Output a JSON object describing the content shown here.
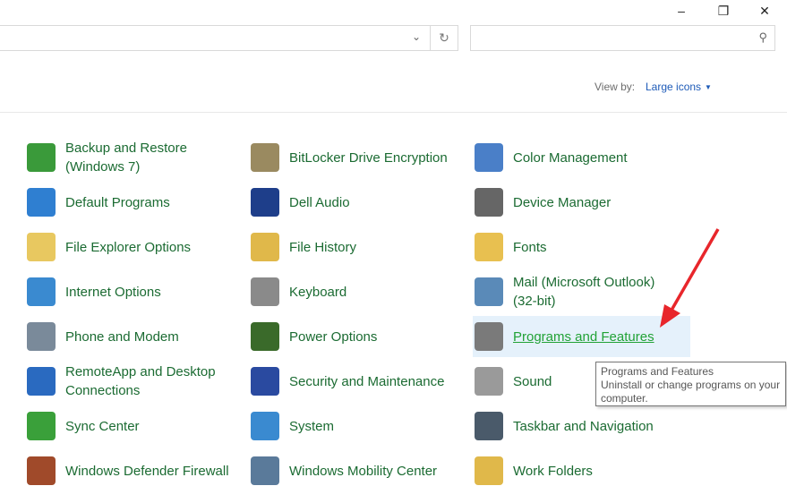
{
  "window": {
    "minimize": "–",
    "restore": "❐",
    "close": "✕"
  },
  "address": {
    "value": "",
    "chevron": "⌄",
    "refresh": "↻"
  },
  "search": {
    "placeholder": "",
    "icon": "⚲"
  },
  "view_by": {
    "label": "View by:",
    "value": "Large icons"
  },
  "items": [
    {
      "label": "Backup and Restore (Windows 7)",
      "icon": "backup-icon",
      "color": "#3a9a3a"
    },
    {
      "label": "BitLocker Drive Encryption",
      "icon": "bitlocker-icon",
      "color": "#9a8a60"
    },
    {
      "label": "Color Management",
      "icon": "color-management-icon",
      "color": "#4a7fc8"
    },
    {
      "label": "Default Programs",
      "icon": "default-programs-icon",
      "color": "#2f7fd1"
    },
    {
      "label": "Dell Audio",
      "icon": "dell-audio-icon",
      "color": "#1e3e8a"
    },
    {
      "label": "Device Manager",
      "icon": "device-manager-icon",
      "color": "#666666"
    },
    {
      "label": "File Explorer Options",
      "icon": "folder-options-icon",
      "color": "#e8c860"
    },
    {
      "label": "File History",
      "icon": "file-history-icon",
      "color": "#e0b84a"
    },
    {
      "label": "Fonts",
      "icon": "fonts-icon",
      "color": "#e8c050"
    },
    {
      "label": "Internet Options",
      "icon": "globe-icon",
      "color": "#3a8ad0"
    },
    {
      "label": "Keyboard",
      "icon": "keyboard-icon",
      "color": "#8a8a8a"
    },
    {
      "label": "Mail (Microsoft Outlook) (32-bit)",
      "icon": "mail-icon",
      "color": "#5a8ab8"
    },
    {
      "label": "Phone and Modem",
      "icon": "phone-icon",
      "color": "#7a8a9a"
    },
    {
      "label": "Power Options",
      "icon": "power-icon",
      "color": "#3a6a2a"
    },
    {
      "label": "Programs and Features",
      "icon": "programs-icon",
      "color": "#7a7a7a"
    },
    {
      "label": "RemoteApp and Desktop Connections",
      "icon": "remoteapp-icon",
      "color": "#2a6ac0"
    },
    {
      "label": "Security and Maintenance",
      "icon": "flag-icon",
      "color": "#2a4aa0"
    },
    {
      "label": "Sound",
      "icon": "speaker-icon",
      "color": "#9a9a9a"
    },
    {
      "label": "Sync Center",
      "icon": "sync-icon",
      "color": "#3aa03a"
    },
    {
      "label": "System",
      "icon": "system-icon",
      "color": "#3a8ad0"
    },
    {
      "label": "Taskbar and Navigation",
      "icon": "taskbar-icon",
      "color": "#4a5a6a"
    },
    {
      "label": "Windows Defender Firewall",
      "icon": "firewall-icon",
      "color": "#a04a2a"
    },
    {
      "label": "Windows Mobility Center",
      "icon": "mobility-icon",
      "color": "#5a7a9a"
    },
    {
      "label": "Work Folders",
      "icon": "work-folders-icon",
      "color": "#e0b84a"
    }
  ],
  "hovered_item": "Programs and Features",
  "tooltip": {
    "title": "Programs and Features",
    "description": "Uninstall or change programs on your computer."
  },
  "annotation": {
    "arrow_color": "#e8262b"
  }
}
